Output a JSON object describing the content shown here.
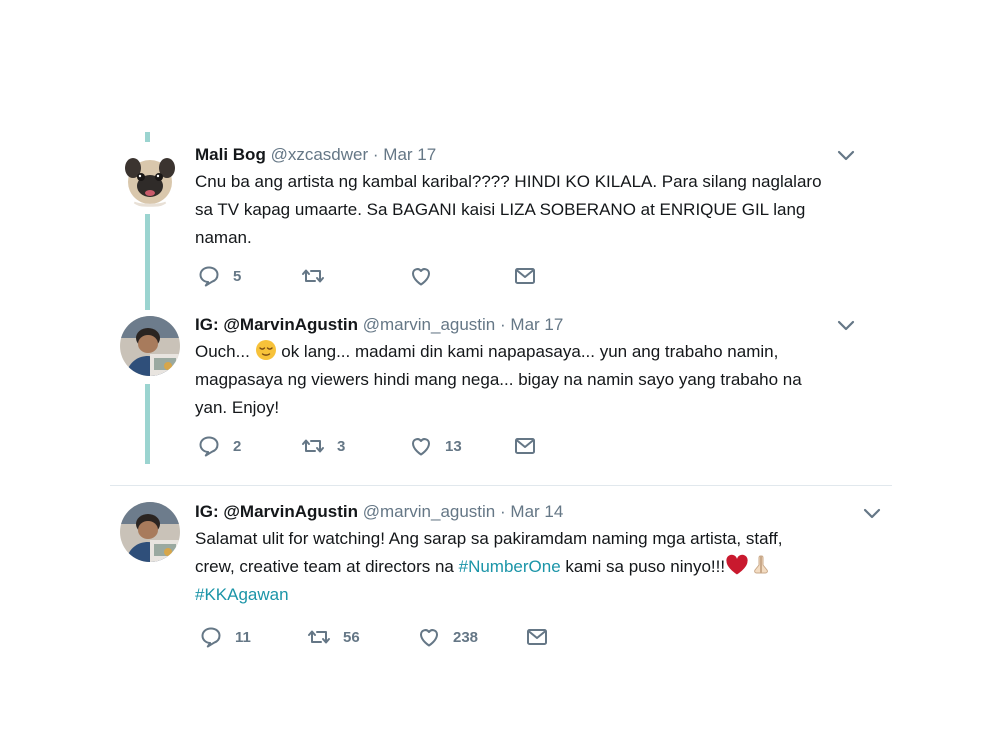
{
  "tweets": [
    {
      "name": "Mali Bog",
      "handle": "@xzcasdwer",
      "separator": "·",
      "date": "Mar 17",
      "text": "Cnu ba ang artista ng kambal karibal???? HINDI KO KILALA. Para silang naglalaro\nsa TV kapag umaarte. Sa BAGANI kaisi LIZA SOBERANO at ENRIQUE GIL lang\nnaman.",
      "reply_count": "5",
      "retweet_count": "",
      "like_count": ""
    },
    {
      "name": "IG: @MarvinAgustin",
      "handle": "@marvin_agustin",
      "separator": "·",
      "date": "Mar 17",
      "text_before": "Ouch... ",
      "text_after": " ok lang... madami din kami napapasaya... yun ang trabaho namin,\nmagpasaya ng viewers hindi mang nega... bigay na namin sayo yang trabaho na\nyan. Enjoy!",
      "reply_count": "2",
      "retweet_count": "3",
      "like_count": "13"
    },
    {
      "name": "IG: @MarvinAgustin",
      "handle": "@marvin_agustin",
      "separator": "·",
      "date": "Mar 14",
      "text_1": "Salamat ulit for watching! Ang sarap sa pakiramdam naming mga artista, staff,\ncrew, creative team at directors na ",
      "hashtag_1": "#NumberOne",
      "text_2": " kami sa puso ninyo!!!",
      "hashtag_2": "#KKAgawan",
      "reply_count": "11",
      "retweet_count": "56",
      "like_count": "238"
    }
  ],
  "icons": {
    "reply": "reply-icon",
    "retweet": "retweet-icon",
    "like": "heart-icon",
    "message": "envelope-icon",
    "caret": "chevron-down-icon"
  },
  "colors": {
    "thread_line": "#9bd4d0",
    "hashtag": "#1b95a8",
    "muted": "#657786"
  }
}
